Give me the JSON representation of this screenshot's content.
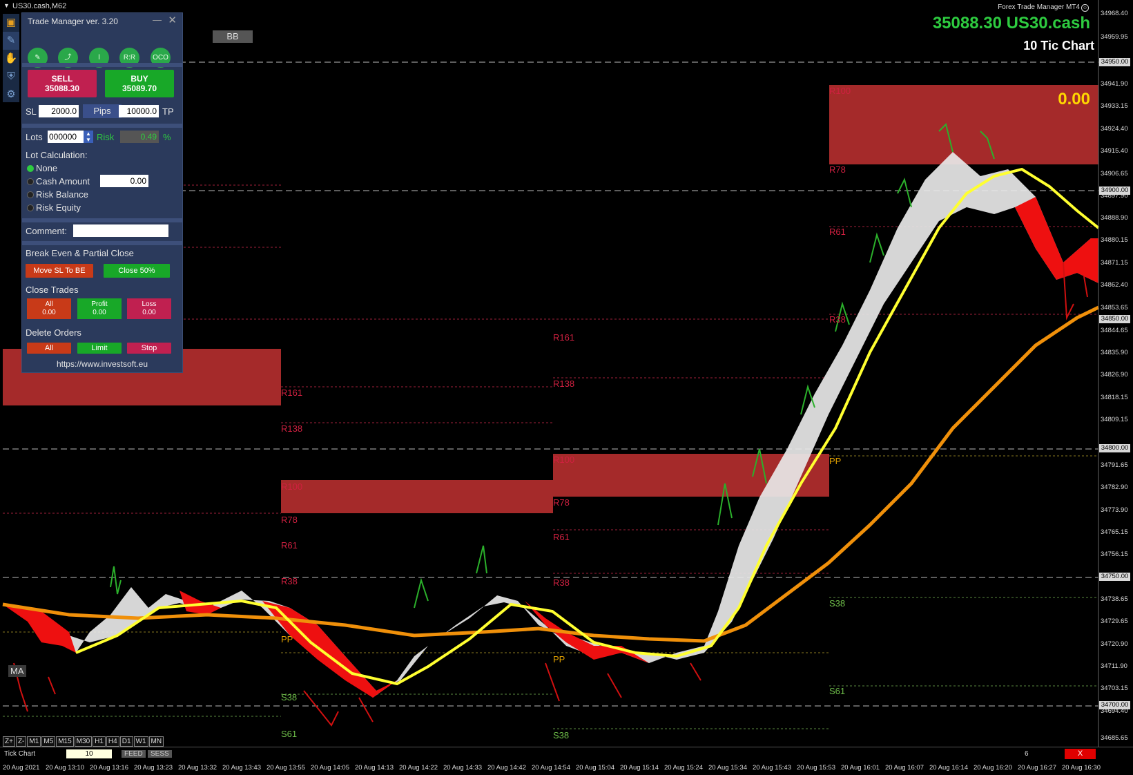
{
  "window": {
    "title": "US30.cash,M62",
    "app_badge": "Forex Trade Manager MT4"
  },
  "chart_header": {
    "price_symbol": "35088.30 US30.cash",
    "chart_type": "10 Tic Chart",
    "pnl": "0.00"
  },
  "indicators": {
    "bb": "BB",
    "ma": "MA"
  },
  "levels": [
    {
      "text": "R78",
      "kind": "r"
    },
    {
      "text": "R61",
      "kind": "r"
    },
    {
      "text": "R38",
      "kind": "r"
    },
    {
      "text": "R161",
      "kind": "r"
    },
    {
      "text": "R138",
      "kind": "r"
    },
    {
      "text": "R161",
      "kind": "r"
    },
    {
      "text": "R138",
      "kind": "r"
    },
    {
      "text": "R78",
      "kind": "r"
    },
    {
      "text": "R61",
      "kind": "r"
    },
    {
      "text": "R38",
      "kind": "r"
    },
    {
      "text": "R78",
      "kind": "r"
    },
    {
      "text": "R61",
      "kind": "r"
    },
    {
      "text": "R38",
      "kind": "r"
    },
    {
      "text": "PP",
      "kind": "p"
    },
    {
      "text": "PP",
      "kind": "p"
    },
    {
      "text": "PP",
      "kind": "p"
    },
    {
      "text": "S38",
      "kind": "s"
    },
    {
      "text": "S61",
      "kind": "s"
    },
    {
      "text": "S38",
      "kind": "s"
    },
    {
      "text": "S38",
      "kind": "s"
    },
    {
      "text": "S61",
      "kind": "s"
    },
    {
      "text": "R100",
      "kind": "r"
    },
    {
      "text": "R100",
      "kind": "r"
    },
    {
      "text": "R100",
      "kind": "r"
    }
  ],
  "price_axis": [
    "34968.40",
    "34959.95",
    "34941.90",
    "34933.15",
    "34924.40",
    "34915.40",
    "34906.65",
    "34897.90",
    "34888.90",
    "34880.15",
    "34871.15",
    "34862.40",
    "34853.65",
    "34844.65",
    "34835.90",
    "34826.90",
    "34818.15",
    "34809.15",
    "34791.65",
    "34782.90",
    "34773.90",
    "34765.15",
    "34756.15",
    "34747.40",
    "34738.65",
    "34729.65",
    "34720.90",
    "34711.90",
    "34703.15",
    "34694.40",
    "34685.65"
  ],
  "price_axis_boxes": [
    "34950.00",
    "34900.00",
    "34850.00",
    "34800.00",
    "34750.00",
    "34700.00"
  ],
  "timeframes": [
    "Z+",
    "Z-",
    "M1",
    "M5",
    "M15",
    "M30",
    "H1",
    "H4",
    "D1",
    "W1",
    "MN"
  ],
  "time_axis": [
    "20 Aug 2021",
    "20 Aug 13:10",
    "20 Aug 13:16",
    "20 Aug 13:23",
    "20 Aug 13:32",
    "20 Aug 13:43",
    "20 Aug 13:55",
    "20 Aug 14:05",
    "20 Aug 14:13",
    "20 Aug 14:22",
    "20 Aug 14:33",
    "20 Aug 14:42",
    "20 Aug 14:54",
    "20 Aug 15:04",
    "20 Aug 15:14",
    "20 Aug 15:24",
    "20 Aug 15:34",
    "20 Aug 15:43",
    "20 Aug 15:53",
    "20 Aug 16:01",
    "20 Aug 16:07",
    "20 Aug 16:14",
    "20 Aug 16:20",
    "20 Aug 16:27",
    "20 Aug 16:30"
  ],
  "bottom_bar": {
    "label": "Tick Chart",
    "value": "10",
    "feed": "FEED",
    "sess": "SESS",
    "count": "6",
    "close": "X"
  },
  "panel": {
    "title": "Trade Manager ver. 3.20",
    "tools": [
      "R:R",
      "OCO"
    ],
    "sell_label": "SELL",
    "sell_price": "35088.30",
    "buy_label": "BUY",
    "buy_price": "35089.70",
    "sl_label": "SL",
    "sl_value": "2000.0",
    "pips": "Pips",
    "tp_value": "10000.0",
    "tp_label": "TP",
    "lots_label": "Lots",
    "lots_value": "000000",
    "risk_label": "Risk",
    "risk_value": "0.49",
    "risk_unit": "%",
    "lot_calc_label": "Lot Calculation:",
    "opt_none": "None",
    "opt_cash": "Cash Amount",
    "cash_value": "0.00",
    "opt_balance": "Risk Balance",
    "opt_equity": "Risk Equity",
    "comment_label": "Comment:",
    "be_label": "Break Even & Partial Close",
    "move_sl": "Move SL To BE",
    "close50": "Close 50%",
    "close_trades": "Close Trades",
    "all_label": "All",
    "all_val": "0.00",
    "profit_label": "Profit",
    "profit_val": "0.00",
    "loss_label": "Loss",
    "loss_val": "0.00",
    "delete_orders": "Delete Orders",
    "del_all": "All",
    "del_limit": "Limit",
    "del_stop": "Stop",
    "url": "https://www.investsoft.eu"
  }
}
